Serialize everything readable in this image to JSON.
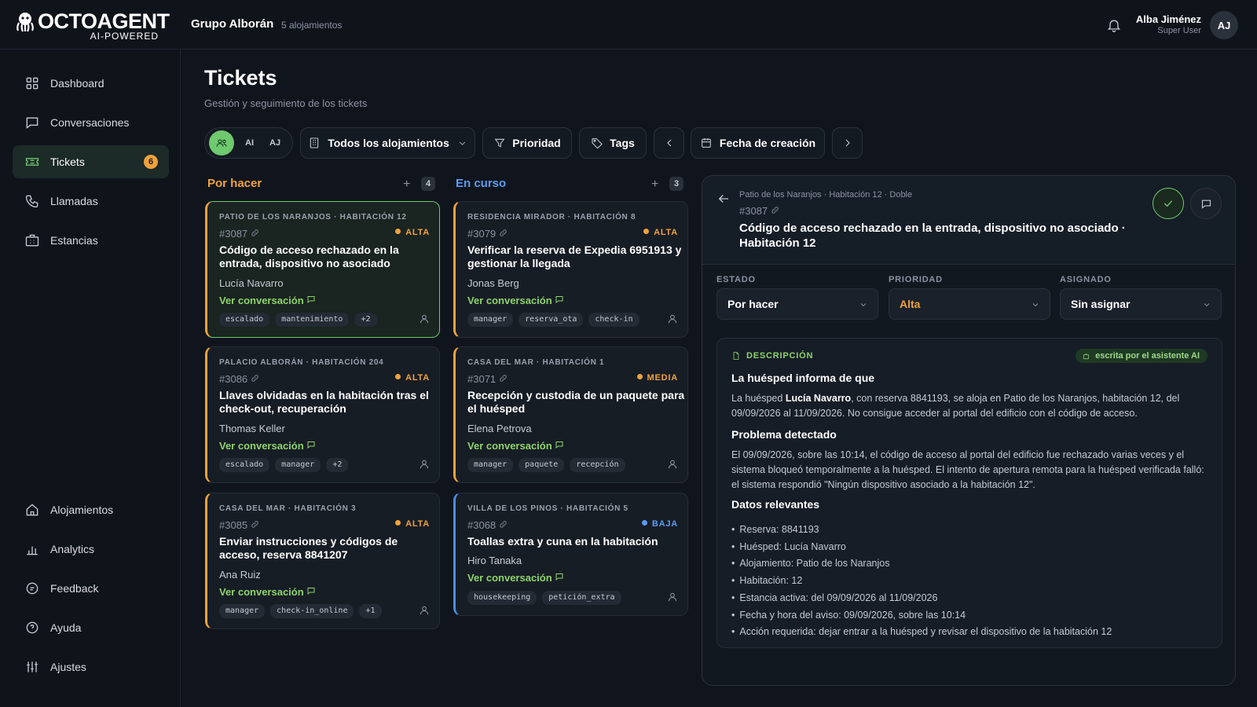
{
  "app": {
    "brand": "OCTOAGENT",
    "tagline": "AI-POWERED"
  },
  "org": {
    "name": "Grupo Alborán",
    "sub": "5 alojamientos"
  },
  "user": {
    "name": "Alba Jiménez",
    "role": "Super User",
    "initials": "AJ"
  },
  "nav": {
    "dashboard": "Dashboard",
    "conversaciones": "Conversaciones",
    "tickets": "Tickets",
    "tickets_badge": "6",
    "llamadas": "Llamadas",
    "estancias": "Estancias",
    "alojamientos": "Alojamientos",
    "analytics": "Analytics",
    "feedback": "Feedback",
    "ayuda": "Ayuda",
    "ajustes": "Ajustes"
  },
  "page": {
    "title": "Tickets",
    "subtitle": "Gestión y seguimiento de los tickets"
  },
  "filters": {
    "seg_ai": "AI",
    "seg_aj": "AJ",
    "alojamientos": "Todos los alojamientos",
    "prioridad": "Prioridad",
    "tags": "Tags",
    "fecha": "Fecha de creación"
  },
  "columns": [
    {
      "title": "Por hacer",
      "count": "4",
      "color": "#f0a23b"
    },
    {
      "title": "En curso",
      "count": "3",
      "color": "#5b9cf0"
    }
  ],
  "cards": [
    {
      "loc": "PATIO DE LOS NARANJOS · HABITACIÓN 12",
      "num": "#3087",
      "prio": "ALTA",
      "title": "Código de acceso rechazado en la entrada, dispositivo no asociado",
      "person": "Lucía Navarro",
      "conv": "Ver conversación",
      "tags": [
        "escalado",
        "mantenimiento",
        "+2"
      ]
    },
    {
      "loc": "PALACIO ALBORÁN · HABITACIÓN 204",
      "num": "#3086",
      "prio": "ALTA",
      "title": "Llaves olvidadas en la habitación tras el check-out, recuperación",
      "person": "Thomas Keller",
      "conv": "Ver conversación",
      "tags": [
        "escalado",
        "manager",
        "+2"
      ]
    },
    {
      "loc": "CASA DEL MAR · HABITACIÓN 3",
      "num": "#3085",
      "prio": "ALTA",
      "title": "Enviar instrucciones y códigos de acceso, reserva 8841207",
      "person": "Ana Ruiz",
      "conv": "Ver conversación",
      "tags": [
        "manager",
        "check-in_online",
        "+1"
      ]
    },
    {
      "loc": "RESIDENCIA MIRADOR · HABITACIÓN 8",
      "num": "#3079",
      "prio": "ALTA",
      "title": "Verificar la reserva de Expedia 6951913 y gestionar la llegada",
      "person": "Jonas Berg",
      "conv": "Ver conversación",
      "tags": [
        "manager",
        "reserva_ota",
        "check-in"
      ]
    },
    {
      "loc": "CASA DEL MAR · HABITACIÓN 1",
      "num": "#3071",
      "prio": "MEDIA",
      "title": "Recepción y custodia de un paquete para el huésped",
      "person": "Elena Petrova",
      "conv": "Ver conversación",
      "tags": [
        "manager",
        "paquete",
        "recepción"
      ]
    },
    {
      "loc": "VILLA DE LOS PINOS · HABITACIÓN 5",
      "num": "#3068",
      "prio": "BAJA",
      "title": "Toallas extra y cuna en la habitación",
      "person": "Hiro Tanaka",
      "conv": "Ver conversación",
      "tags": [
        "housekeeping",
        "petición_extra"
      ]
    }
  ],
  "detail": {
    "crumb": "Patio de los Naranjos · Habitación 12 · Doble",
    "num": "#3087",
    "title": "Código de acceso rechazado en la entrada, dispositivo no asociado · Habitación 12",
    "estado_label": "ESTADO",
    "estado": "Por hacer",
    "prioridad_label": "PRIORIDAD",
    "prioridad": "Alta",
    "asignado_label": "ASIGNADO",
    "asignado": "Sin asignar",
    "desc_label": "DESCRIPCIÓN",
    "ai_pill": "escrita por el asistente AI",
    "h1": "La huésped informa de que",
    "p1_a": "La huésped ",
    "p1_name": "Lucía Navarro",
    "p1_b": ", con reserva 8841193, se aloja en Patio de los Naranjos, habitación 12, del 09/09/2026 al 11/09/2026. No consigue acceder al portal del edificio con el código de acceso.",
    "h2": "Problema detectado",
    "p2": "El 09/09/2026, sobre las 10:14, el código de acceso al portal del edificio fue rechazado varias veces y el sistema bloqueó temporalmente a la huésped. El intento de apertura remota para la huésped verificada falló: el sistema respondió \"Ningún dispositivo asociado a la habitación 12\".",
    "h3": "Datos relevantes",
    "items": [
      "Reserva: 8841193",
      "Huésped: Lucía Navarro",
      "Alojamiento: Patio de los Naranjos",
      "Habitación: 12",
      "Estancia activa: del 09/09/2026 al 11/09/2026",
      "Fecha y hora del aviso: 09/09/2026, sobre las 10:14",
      "Acción requerida: dejar entrar a la huésped y revisar el dispositivo de la habitación 12"
    ]
  },
  "colors": {
    "accent": "#6fc96f",
    "alta": "#f0a23b",
    "media": "#f0a23b",
    "baja": "#5b9cf0",
    "background": "#10151d"
  }
}
